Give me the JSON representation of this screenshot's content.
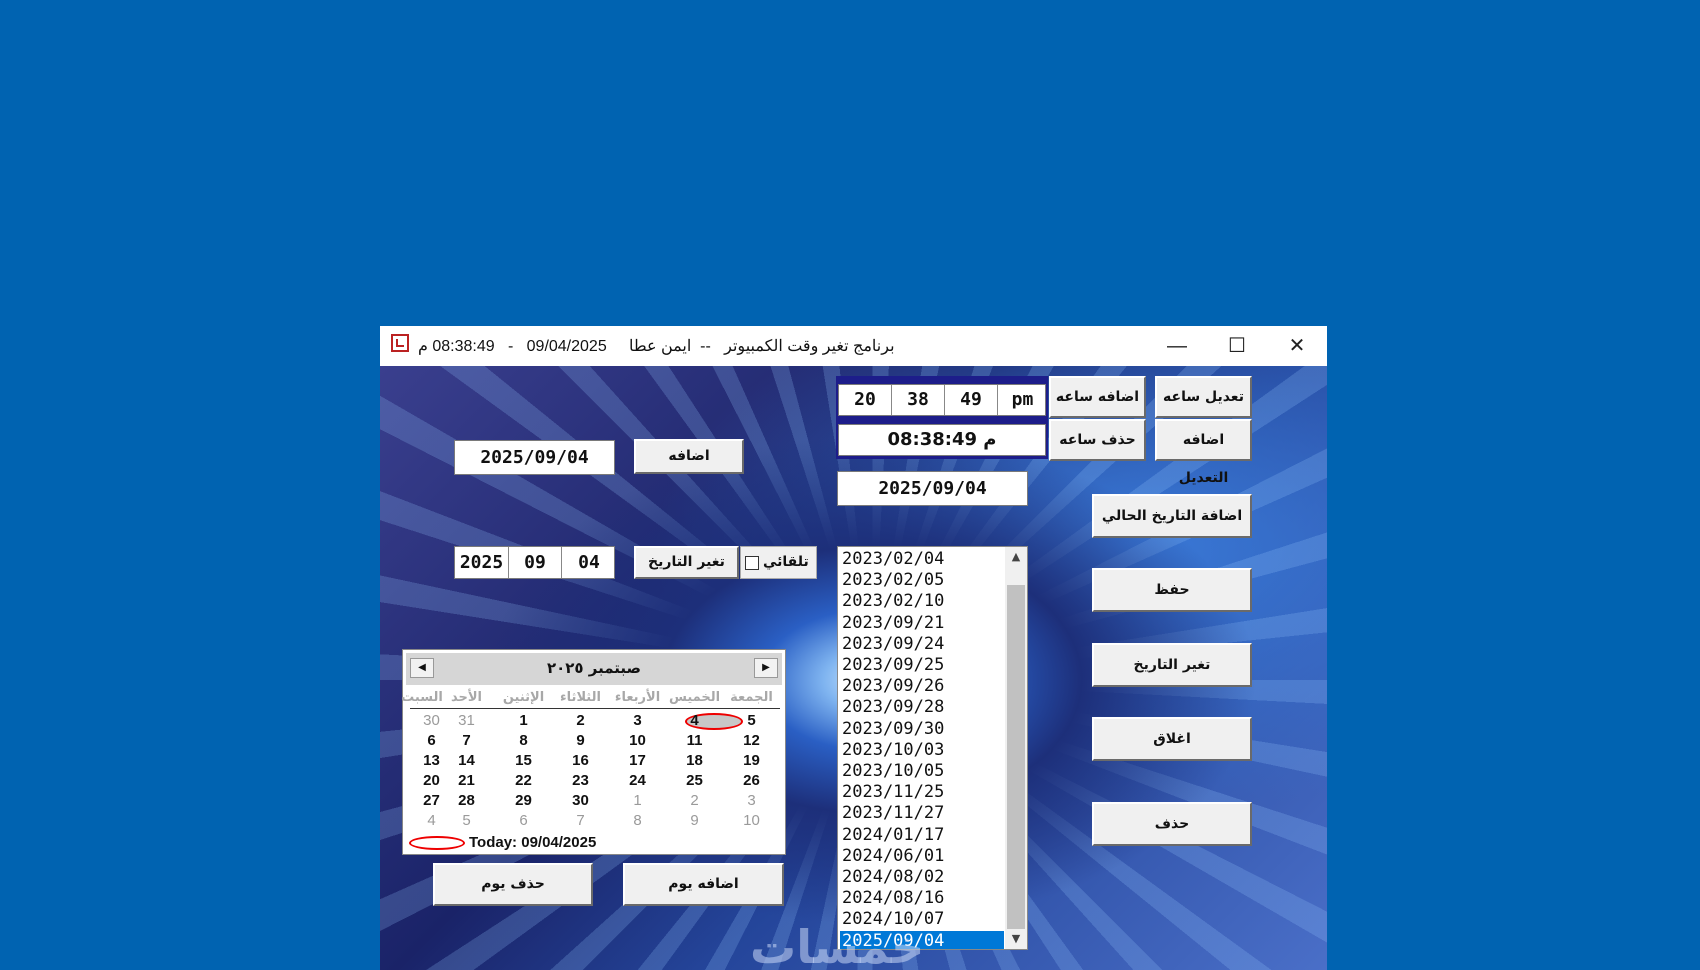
{
  "window": {
    "title": "برنامج تغير وقت الكمبيوتر   --  ايمن عطا     09/04/2025   -   08:38:49 م",
    "minimize_glyph": "—",
    "maximize_glyph": "☐",
    "close_glyph": "✕"
  },
  "time_panel": {
    "hours": "20",
    "minutes": "38",
    "seconds": "49",
    "ampm": "pm",
    "time_display": "08:38:49 م",
    "add_hour_label": "اضافه ساعه",
    "edit_hour_label": "تعديل ساعه",
    "delete_hour_label": "حذف  ساعه",
    "add_edit_label": "اضافه التعديل"
  },
  "left_panel": {
    "date_field": "2025/09/04",
    "add_label": "اضافه",
    "year": "2025",
    "month": "09",
    "day": "04",
    "change_date_label": "تغير التاريخ",
    "auto_label": "تلقائي",
    "add_day_label": "اضافه يوم",
    "delete_day_label": "حذف يوم"
  },
  "calendar": {
    "month_title": "صبتمبر ٢٠٢٥",
    "prev_glyph": "◀",
    "next_glyph": "▶",
    "weekdays": [
      "الجمعة",
      "الخميس",
      "الأربعاء",
      "الثلاثاء",
      "الإثنين",
      "الأحد",
      "السبت"
    ],
    "weeks": [
      [
        "5",
        "4",
        "3",
        "2",
        "1",
        "31",
        "30"
      ],
      [
        "12",
        "11",
        "10",
        "9",
        "8",
        "7",
        "6"
      ],
      [
        "19",
        "18",
        "17",
        "16",
        "15",
        "14",
        "13"
      ],
      [
        "26",
        "25",
        "24",
        "23",
        "22",
        "21",
        "20"
      ],
      [
        "3",
        "2",
        "1",
        "30",
        "29",
        "28",
        "27"
      ],
      [
        "10",
        "9",
        "8",
        "7",
        "6",
        "5",
        "4"
      ]
    ],
    "today_text": "Today: 09/04/2025"
  },
  "date_list": {
    "current": "2025/09/04",
    "items": [
      "2023/02/04",
      "2023/02/05",
      "2023/02/10",
      "2023/09/21",
      "2023/09/24",
      "2023/09/25",
      "2023/09/26",
      "2023/09/28",
      "2023/09/30",
      "2023/10/03",
      "2023/10/05",
      "2023/11/25",
      "2023/11/27",
      "2024/01/17",
      "2024/06/01",
      "2024/08/02",
      "2024/08/16",
      "2024/10/07",
      "2025/09/04"
    ],
    "selected": "2025/09/04"
  },
  "right_buttons": {
    "add_current_date": "اضافة التاريخ الحالي",
    "save": "حفظ",
    "change_date": "تغير التاريخ",
    "close": "اغلاق",
    "delete": "حذف"
  },
  "colors": {
    "desktop": "#0063b1",
    "selection": "#0078d7",
    "today_ring": "#e00000"
  },
  "watermark": "خمسات"
}
